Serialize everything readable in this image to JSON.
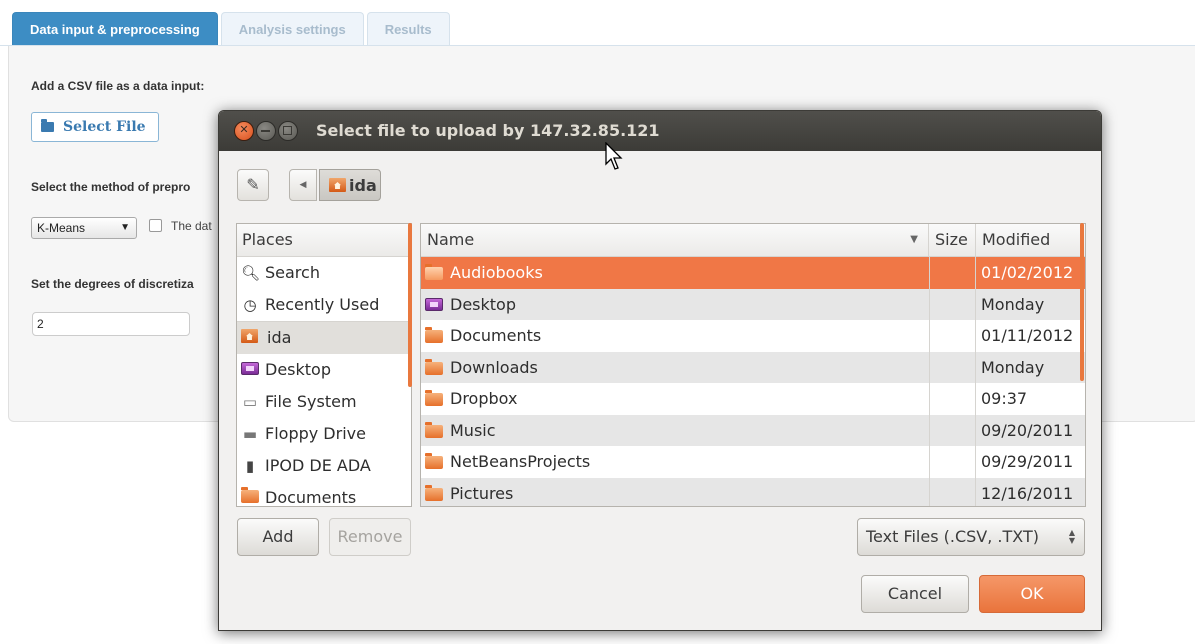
{
  "app": {
    "tabs": [
      {
        "label": "Data input & preprocessing",
        "active": true
      },
      {
        "label": "Analysis settings",
        "active": false
      },
      {
        "label": "Results",
        "active": false
      }
    ],
    "csv_label": "Add a CSV file as a data input:",
    "select_file_label": "Select File",
    "method_label": "Select the method of prepro",
    "method_value": "K-Means",
    "checkbox_label": "The dat",
    "discretization_label": "Set the degrees of discretiza",
    "discretization_value": "2"
  },
  "dialog": {
    "title": "Select file to upload by 147.32.85.121",
    "path_crumb": "ida",
    "places_header": "Places",
    "places": [
      {
        "label": "Search",
        "icon": "search-icon"
      },
      {
        "label": "Recently Used",
        "icon": "clock-icon"
      },
      {
        "label": "ida",
        "icon": "home-folder-icon",
        "selected": true
      },
      {
        "label": "Desktop",
        "icon": "desktop-icon"
      },
      {
        "label": "File System",
        "icon": "hard-drive-icon"
      },
      {
        "label": "Floppy Drive",
        "icon": "floppy-drive-icon"
      },
      {
        "label": "IPOD DE ADA",
        "icon": "ipod-icon"
      },
      {
        "label": "Documents",
        "icon": "documents-folder-icon"
      }
    ],
    "columns": {
      "name": "Name",
      "size": "Size",
      "modified": "Modified"
    },
    "files": [
      {
        "name": "Audiobooks",
        "modified": "01/02/2012",
        "icon": "folder-icon",
        "selected": true
      },
      {
        "name": "Desktop",
        "modified": "Monday",
        "icon": "desktop-icon"
      },
      {
        "name": "Documents",
        "modified": "01/11/2012",
        "icon": "documents-folder-icon"
      },
      {
        "name": "Downloads",
        "modified": "Monday",
        "icon": "downloads-folder-icon"
      },
      {
        "name": "Dropbox",
        "modified": "09:37",
        "icon": "folder-icon"
      },
      {
        "name": "Music",
        "modified": "09/20/2011",
        "icon": "music-folder-icon"
      },
      {
        "name": "NetBeansProjects",
        "modified": "09/29/2011",
        "icon": "folder-icon"
      },
      {
        "name": "Pictures",
        "modified": "12/16/2011",
        "icon": "pictures-folder-icon"
      }
    ],
    "add_label": "Add",
    "remove_label": "Remove",
    "filter_value": "Text Files (.CSV, .TXT)",
    "cancel_label": "Cancel",
    "ok_label": "OK"
  },
  "colors": {
    "accent_blue": "#3d8dc4",
    "selection_orange": "#f07746",
    "titlebar_dark": "#3c3b37"
  }
}
